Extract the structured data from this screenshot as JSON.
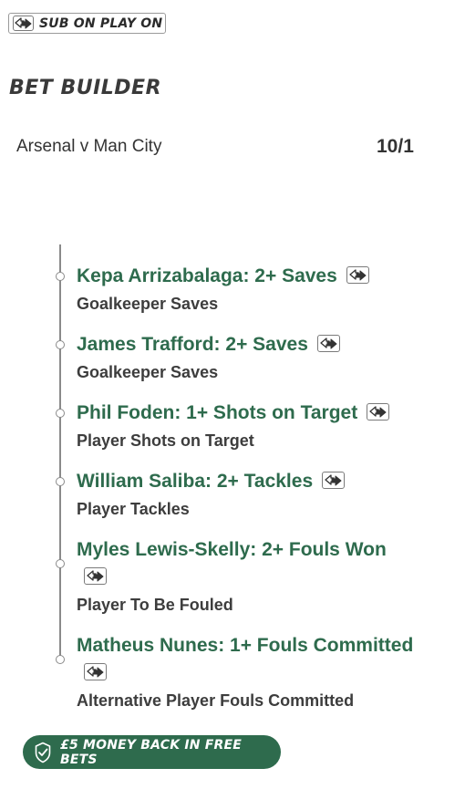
{
  "header": {
    "sub_badge_label": "SUB ON PLAY ON",
    "sub_badge_icon": "swap-player-icon"
  },
  "title": "BET BUILDER",
  "match": {
    "name": "Arsenal v Man City",
    "odds": "10/1"
  },
  "legs": [
    {
      "title": "Kepa Arrizabalaga: 2+ Saves",
      "market": "Goalkeeper Saves",
      "icon": "swap-player-icon"
    },
    {
      "title": "James Trafford: 2+ Saves",
      "market": "Goalkeeper Saves",
      "icon": "swap-player-icon"
    },
    {
      "title": "Phil Foden: 1+ Shots on Target",
      "market": "Player Shots on Target",
      "icon": "swap-player-icon"
    },
    {
      "title": "William Saliba: 2+ Tackles",
      "market": "Player Tackles",
      "icon": "swap-player-icon"
    },
    {
      "title": "Myles Lewis-Skelly: 2+ Fouls Won",
      "market": "Player To Be Fouled",
      "icon": "swap-player-icon"
    },
    {
      "title": "Matheus Nunes: 1+ Fouls Committed",
      "market": "Alternative Player Fouls Committed",
      "icon": "swap-player-icon"
    }
  ],
  "promo": {
    "label": "£5 MONEY BACK IN FREE BETS",
    "icon": "shield-check-icon"
  },
  "colors": {
    "leg_title": "#2e6b4d",
    "promo_bg": "#2e6b4d",
    "text": "#333333"
  }
}
